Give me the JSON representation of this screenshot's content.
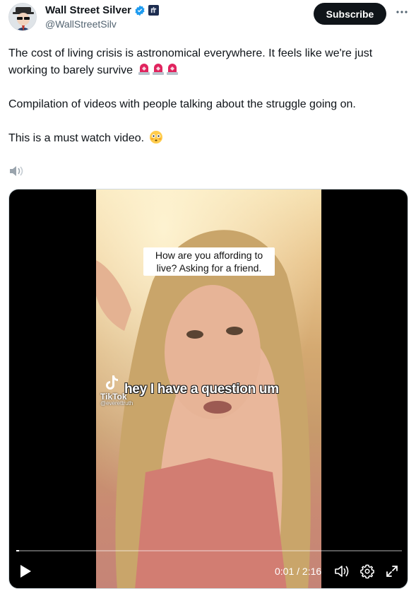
{
  "author": {
    "display_name": "Wall Street Silver",
    "handle": "@WallStreetSilv",
    "verified_icon": "verified-badge-icon",
    "affiliate_icon": "affiliate-badge-icon"
  },
  "actions": {
    "subscribe_label": "Subscribe",
    "more_icon": "more-options-icon"
  },
  "tweet": {
    "paragraph_1": "The cost of living crisis is astronomical everywhere. It feels like we're just working to barely survive",
    "paragraph_1_emoji": "siren-icon x3",
    "paragraph_2": "Compilation of videos with people talking about the struggle going on.",
    "paragraph_3": "This is a must watch video.",
    "paragraph_3_emoji": "flushed-face-icon"
  },
  "video": {
    "caption_box": "How are you affording to live? Asking for a friend.",
    "subtitle": "hey I have a question um",
    "watermark_brand": "TikTok",
    "watermark_handle": "@everettruth",
    "current_time": "0:01",
    "separator": " / ",
    "duration": "2:16",
    "progress_fraction": 0.008
  },
  "colors": {
    "subscribe_bg": "#0f1419",
    "verified_blue": "#1d9bf0",
    "siren_red": "#e0245e"
  }
}
